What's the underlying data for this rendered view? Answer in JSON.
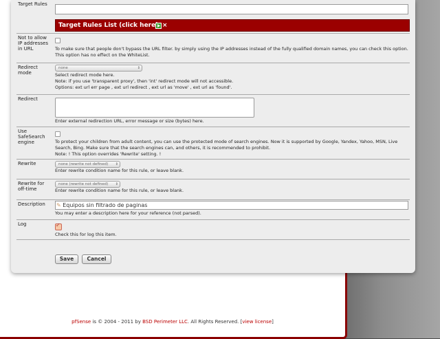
{
  "fields": {
    "target_rules": {
      "label": "Target Rules",
      "value": "",
      "list_button": "Target Rules List (click here)"
    },
    "not_allow_ip": {
      "label": "Not to allow IP addresses in URL",
      "checked": false,
      "help": "To make sure that people don't bypass the URL filter. by simply using the IP addresses instead of the fully qualified domain names, you can check this option. This option has no effect on the WhiteList."
    },
    "redirect_mode": {
      "label": "Redirect mode",
      "selected": "none",
      "help_1": "Select redirect mode here.",
      "help_2": "Note: if you use 'transparent proxy', then 'int' redirect mode will not accessible.",
      "help_3": "Options: ext url err page , ext url redirect , ext url as 'move' , ext url as 'found'."
    },
    "redirect": {
      "label": "Redirect",
      "value": "",
      "help": "Enter external redirection URL, error message or size (bytes) here."
    },
    "safesearch": {
      "label": "Use SafeSearch engine",
      "checked": false,
      "help_1": "To protect your children from adult content, you can use the protected mode of search engines. Now it is supported by Google, Yandex, Yahoo, MSN, Live Search, Bing. Make sure that the search engines can, and others, it is recommended to prohibit.",
      "help_2": "Note: ! This option overrides 'Rewrite' setting. !"
    },
    "rewrite": {
      "label": "Rewrite",
      "selected": "none (rewrite not defined)",
      "help": "Enter rewrite condition name for this rule, or leave blank."
    },
    "rewrite_offtime": {
      "label": "Rewrite for off-time",
      "selected": "none (rewrite not defined)",
      "help": "Enter rewrite condition name for this rule, or leave blank."
    },
    "description": {
      "label": "Description",
      "value": "Equipos sin filtrado de paginas",
      "help": "You may enter a description here for your reference (not parsed)."
    },
    "log": {
      "label": "Log",
      "checked": true,
      "help": "Check this for log this item."
    }
  },
  "buttons": {
    "save": "Save",
    "cancel": "Cancel"
  },
  "footer": {
    "brand": "pfSense",
    "text": " is © 2004 - 2011 by ",
    "company": "BSD Perimeter LLC",
    "rights": ". All Rights Reserved. [",
    "license": "view license",
    "close": "]"
  },
  "colors": {
    "accent_red": "#9b0000",
    "panel_bg": "#ededed",
    "brand_red": "#b00000"
  },
  "icons": [
    "add-icon",
    "delete-icon",
    "pencil-icon",
    "checkbox-checked-icon"
  ]
}
